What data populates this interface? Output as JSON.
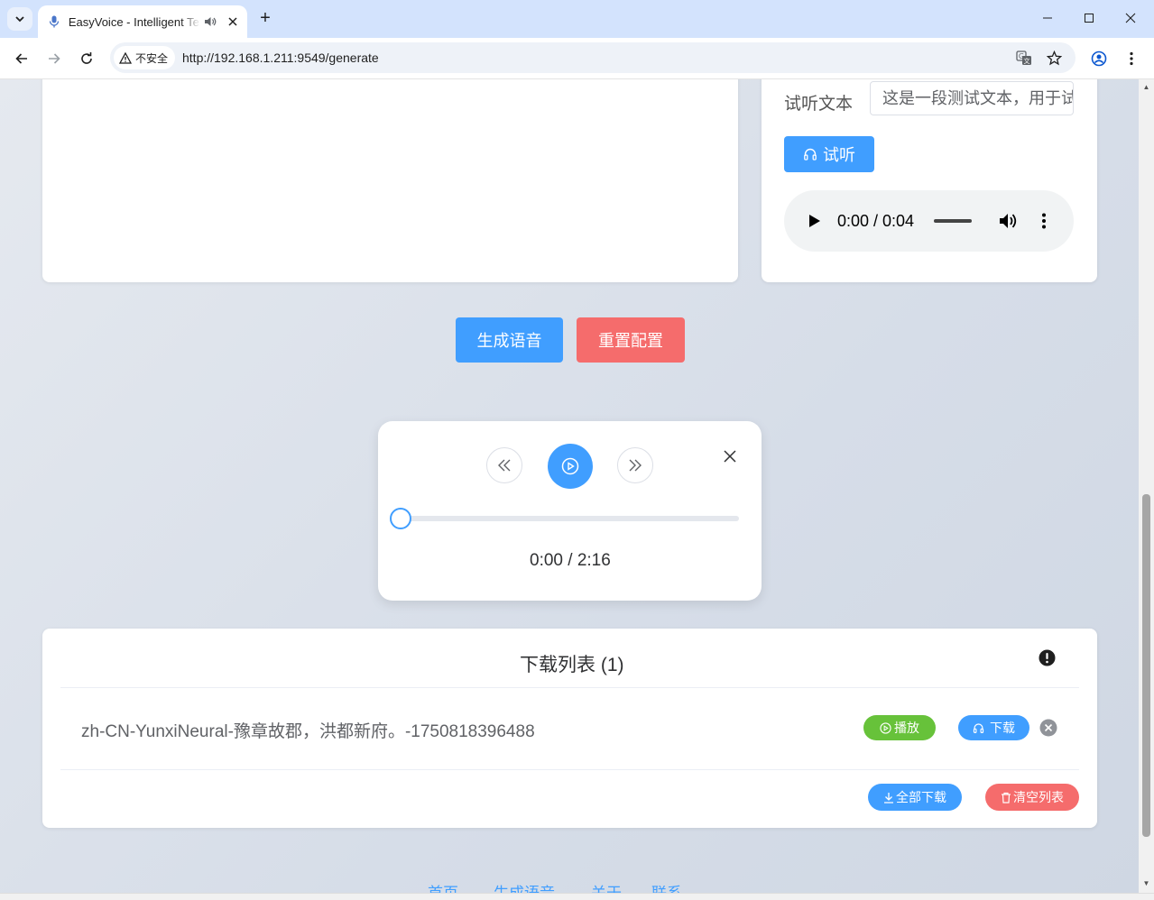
{
  "browser": {
    "tab_title": "EasyVoice - Intelligent Text to Speech",
    "security_label": "不安全",
    "url": "http://192.168.1.211:9549/generate"
  },
  "preview": {
    "label": "试听文本",
    "input_value": "这是一段测试文本，用于试听",
    "button_label": "试听",
    "audio_time": "0:00 / 0:04"
  },
  "actions": {
    "generate_label": "生成语音",
    "reset_label": "重置配置"
  },
  "player": {
    "time": "0:00 / 2:16",
    "progress": 0
  },
  "downloads": {
    "title": "下载列表 (1)",
    "items": [
      {
        "name": "zh-CN-YunxiNeural-豫章故郡，洪都新府。-1750818396488",
        "play_label": "播放",
        "download_label": "下载"
      }
    ],
    "download_all_label": "全部下载",
    "clear_label": "清空列表"
  },
  "footer": {
    "links": [
      "首页",
      "生成语音",
      "关于",
      "联系"
    ]
  },
  "colors": {
    "primary": "#409eff",
    "danger": "#f56c6c",
    "success": "#67c23a"
  }
}
